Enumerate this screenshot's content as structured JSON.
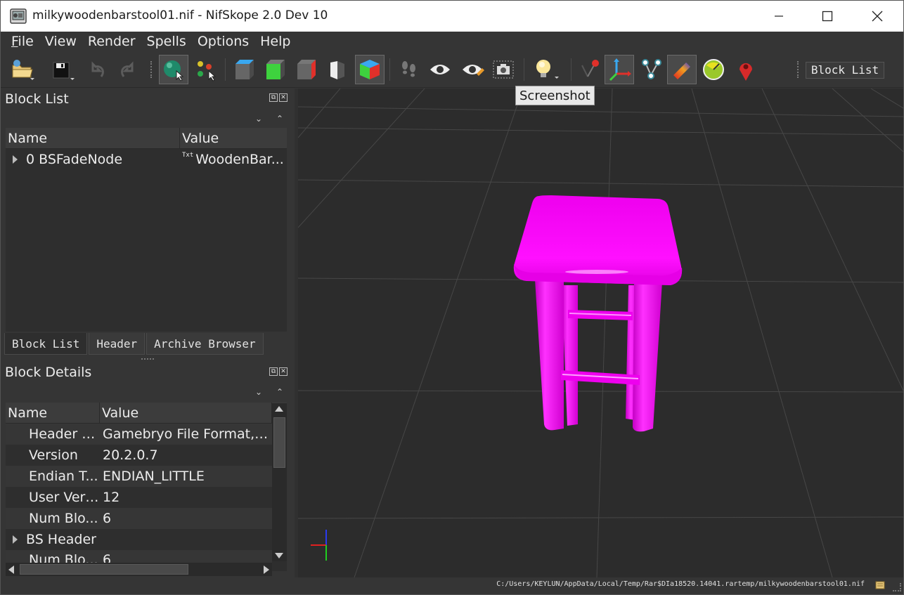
{
  "window": {
    "title": "milkywoodenbarstool01.nif - NifSkope 2.0 Dev 10"
  },
  "menu": [
    {
      "label": "File",
      "ul": "F",
      "rest": "ile"
    },
    {
      "label": "View",
      "ul": "",
      "rest": "View"
    },
    {
      "label": "Render",
      "ul": "",
      "rest": "Render"
    },
    {
      "label": "Spells",
      "ul": "",
      "rest": "Spells"
    },
    {
      "label": "Options",
      "ul": "",
      "rest": "Options"
    },
    {
      "label": "Help",
      "ul": "",
      "rest": "Help"
    }
  ],
  "toolbar": {
    "blocklist_label": "Block List",
    "tooltip": "Screenshot"
  },
  "block_list": {
    "title": "Block List",
    "columns": [
      "Name",
      "Value"
    ],
    "rows": [
      {
        "name": "0 BSFadeNode",
        "value": "WoodenBar..."
      }
    ],
    "value_badge": "Txt"
  },
  "tabs": [
    "Block List",
    "Header",
    "Archive Browser"
  ],
  "block_details": {
    "title": "Block Details",
    "columns": [
      "Name",
      "Value"
    ],
    "rows": [
      {
        "name": "Header S...",
        "value": "Gamebryo File Format, Ve...",
        "expandable": false
      },
      {
        "name": "Version",
        "value": "20.2.0.7",
        "expandable": false
      },
      {
        "name": "Endian T...",
        "value": "ENDIAN_LITTLE",
        "expandable": false
      },
      {
        "name": "User Vers...",
        "value": "12",
        "expandable": false
      },
      {
        "name": "Num Blo...",
        "value": "6",
        "expandable": false
      },
      {
        "name": "BS Header",
        "value": "",
        "expandable": true
      },
      {
        "name": "Num Blo...",
        "value": "6",
        "expandable": false
      }
    ]
  },
  "status": {
    "path": "C:/Users/KEYLUN/AppData/Local/Temp/Rar$DIa18520.14041.rartemp/milkywoodenbarstool01.nif"
  },
  "colors": {
    "model": "#ff00ff",
    "grid": "#4a4a4a",
    "viewport_bg": "#2c2c2c"
  }
}
